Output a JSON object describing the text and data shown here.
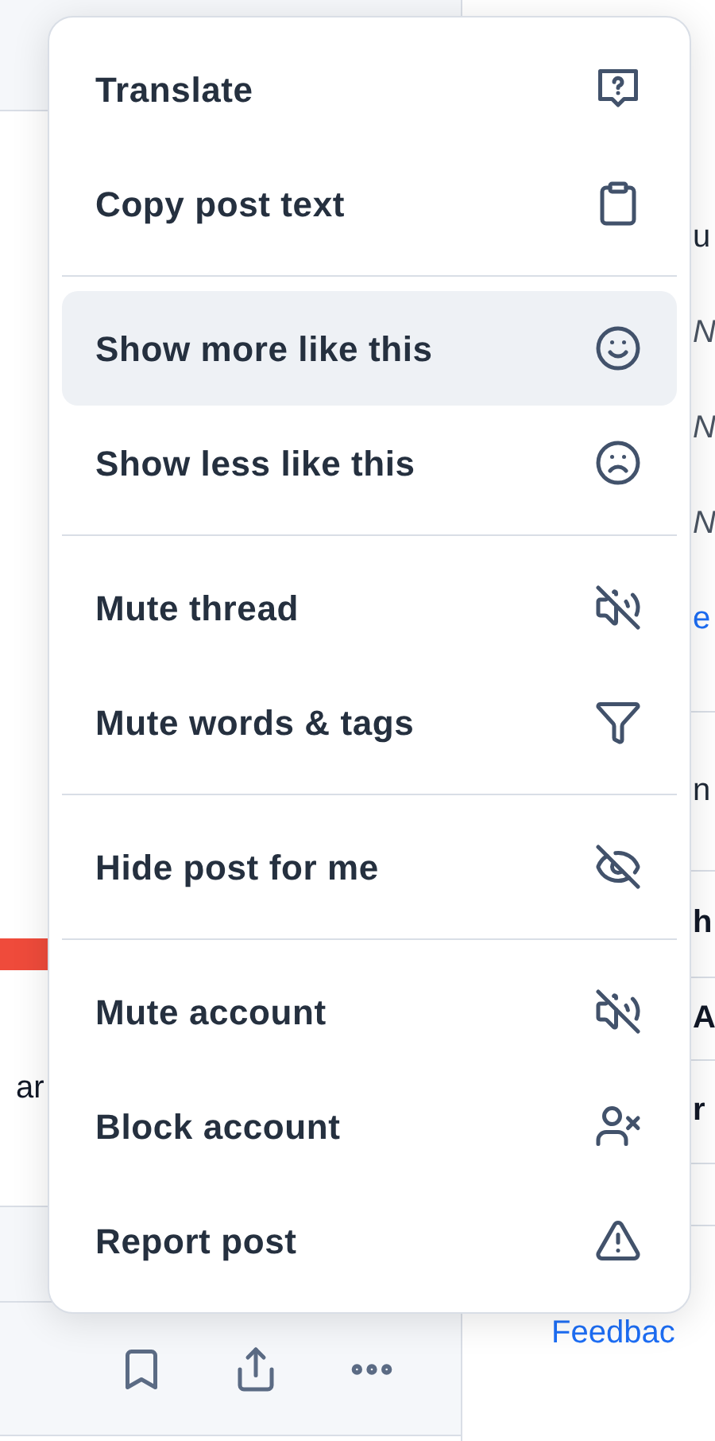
{
  "feed": {
    "snippet": "ar"
  },
  "sidebar": {
    "fragments": [
      {
        "text": "u",
        "kind": "plain"
      },
      {
        "text": "N",
        "kind": "italic"
      },
      {
        "text": "N",
        "kind": "italic"
      },
      {
        "text": "N",
        "kind": "italic"
      },
      {
        "text": "e",
        "kind": "link"
      },
      {
        "text": "n",
        "kind": "plain"
      },
      {
        "text": "h",
        "kind": "bold"
      },
      {
        "text": "A",
        "kind": "bold"
      },
      {
        "text": "r",
        "kind": "bold"
      }
    ],
    "link": "Feedbac"
  },
  "menu": {
    "groups": [
      [
        {
          "label": "Translate",
          "selected": false
        },
        {
          "label": "Copy post text",
          "selected": false
        }
      ],
      [
        {
          "label": "Show more like this",
          "selected": true
        },
        {
          "label": "Show less like this",
          "selected": false
        }
      ],
      [
        {
          "label": "Mute thread",
          "selected": false
        },
        {
          "label": "Mute words & tags",
          "selected": false
        }
      ],
      [
        {
          "label": "Hide post for me",
          "selected": false
        }
      ],
      [
        {
          "label": "Mute account",
          "selected": false
        },
        {
          "label": "Block account",
          "selected": false
        },
        {
          "label": "Report post",
          "selected": false
        }
      ]
    ]
  }
}
